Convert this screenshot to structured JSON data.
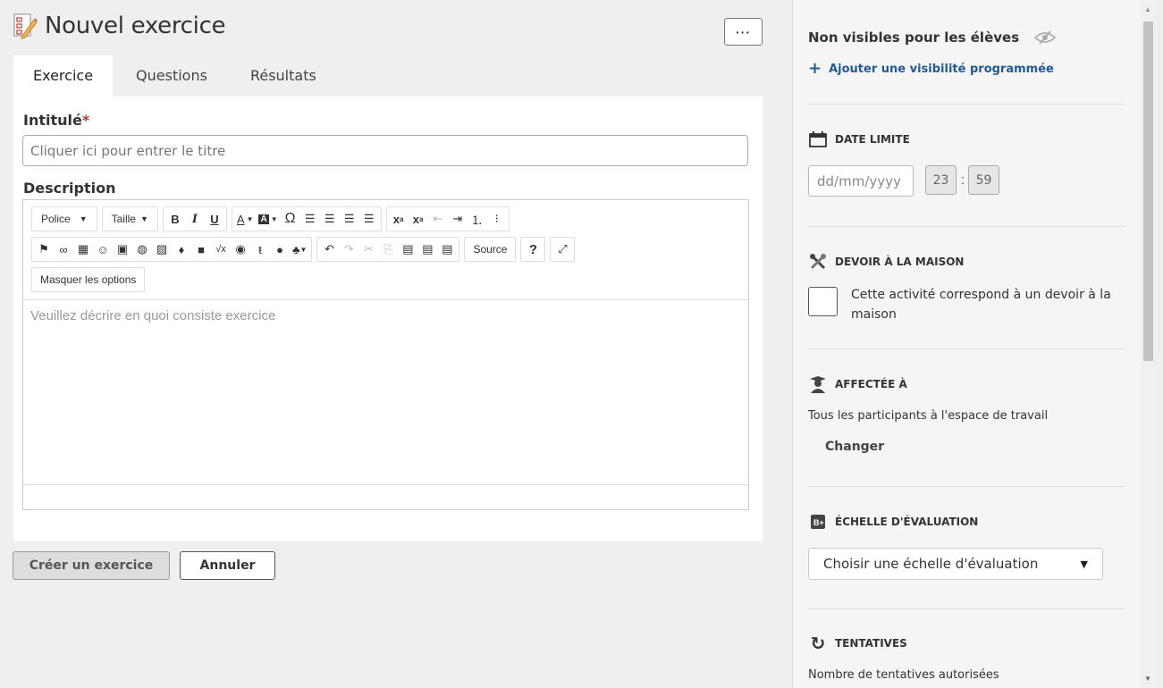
{
  "header": {
    "title": "Nouvel exercice",
    "more_label": "···"
  },
  "tabs": [
    {
      "label": "Exercice",
      "active": true
    },
    {
      "label": "Questions",
      "active": false
    },
    {
      "label": "Résultats",
      "active": false
    }
  ],
  "form": {
    "title_label": "Intitulé",
    "title_required_mark": "*",
    "title_placeholder": "Cliquer ici pour entrer le titre",
    "description_label": "Description",
    "description_placeholder": "Veuillez décrire en quoi consiste exercice"
  },
  "editor_toolbar": {
    "font_combo": "Police",
    "size_combo": "Taille",
    "source_label": "Source",
    "help_label": "?",
    "hide_options_label": "Masquer les options"
  },
  "actions": {
    "create_label": "Créer un exercice",
    "cancel_label": "Annuler"
  },
  "sidebar": {
    "visibility_title": "Non visibles pour les élèves",
    "add_visibility_label": "Ajouter une visibilité programmée",
    "deadline": {
      "title": "DATE LIMITE",
      "date_placeholder": "dd/mm/yyyy",
      "hour": "23",
      "minute": "59",
      "separator": ":"
    },
    "homework": {
      "title": "DEVOIR À LA MAISON",
      "checkbox_label": "Cette activité correspond à un devoir à la maison",
      "checked": false
    },
    "assigned": {
      "title": "AFFECTÉE À",
      "value": "Tous les participants à l'espace de travail",
      "change_label": "Changer"
    },
    "scale": {
      "title": "ÉCHELLE D'ÉVALUATION",
      "selected": "Choisir une échelle d'évaluation"
    },
    "attempts": {
      "title": "TENTATIVES",
      "label": "Nombre de tentatives autorisées"
    }
  },
  "colors": {
    "accent_link": "#1f5a99",
    "required": "#b03a2e",
    "page_bg": "#efefef",
    "sidebar_bg": "#f5f5f5"
  }
}
